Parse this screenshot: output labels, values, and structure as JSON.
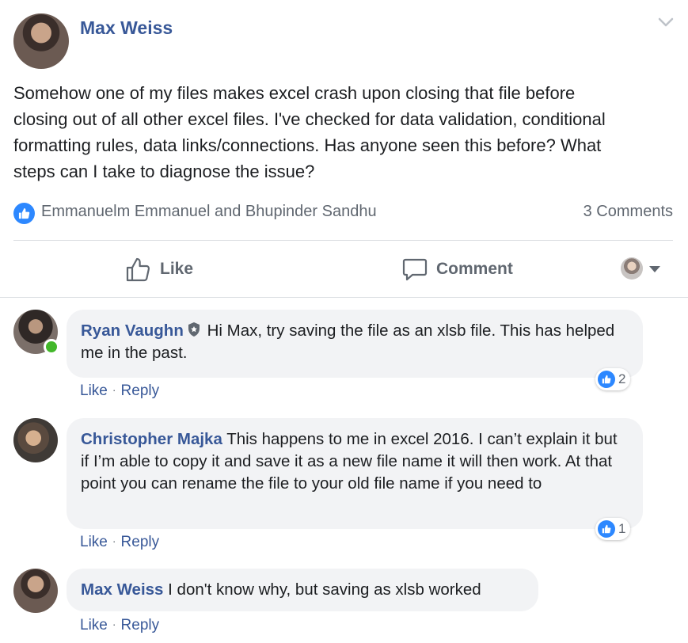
{
  "post": {
    "author": "Max Weiss",
    "text_lines": [
      "Somehow one of my files makes excel crash upon closing that file before",
      "closing out of all other excel files. I've checked for data validation, conditional",
      "formatting rules, data links/connections. Has anyone seen this before? What",
      "steps can I take to diagnose the issue?"
    ],
    "reactors": "Emmanuelm Emmanuel and Bhupinder Sandhu",
    "comment_count": "3 Comments"
  },
  "actions": {
    "like": "Like",
    "comment": "Comment"
  },
  "comments": [
    {
      "author": "Ryan Vaughn",
      "text": "Hi Max, try saving the file as an xlsb file. This has helped me in the past.",
      "reactions": "2",
      "like": "Like",
      "reply": "Reply",
      "separator": "·"
    },
    {
      "author": "Christopher Majka",
      "text": "This happens to me in excel 2016. I can’t explain it but if I’m able to copy it and save it as a new file name it will then work. At that point you can rename the file to your old file name if you need to",
      "reactions": "1",
      "like": "Like",
      "reply": "Reply",
      "separator": "·"
    },
    {
      "author": "Max Weiss",
      "text": "I don't know why, but saving as xlsb worked",
      "like": "Like",
      "reply": "Reply",
      "separator": "·"
    }
  ],
  "colors": {
    "name": "#385898",
    "like_blue": "#2d88ff",
    "bubble": "#f2f3f5",
    "meta": "#606770",
    "online": "#42b72a"
  },
  "icons": [
    "chevron-down-icon",
    "like-reaction-icon",
    "thumbs-up-icon",
    "comment-icon",
    "caret-down-icon",
    "shield-icon"
  ]
}
